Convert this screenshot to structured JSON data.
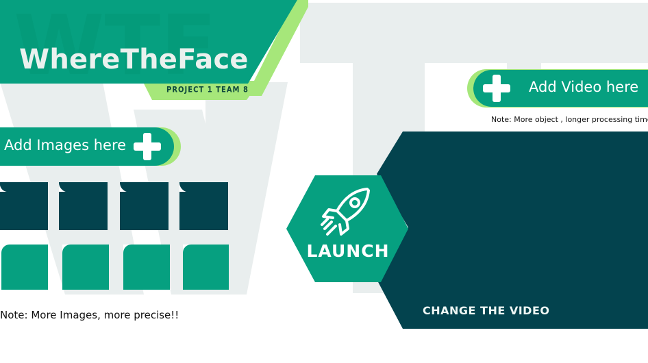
{
  "header": {
    "watermark_text": "WTF",
    "app_title": "WhereTheFace",
    "subtitle": "PROJECT 1 TEAM 8"
  },
  "images": {
    "add_label": "Add Images here",
    "note": "Note: More Images, more precise!!",
    "slots_top_count": 4,
    "slots_bottom_count": 4
  },
  "video": {
    "add_label": "Add Video here",
    "note": "Note: More object , longer processing time",
    "change_label": "CHANGE THE VIDEO"
  },
  "launch": {
    "label": "LAUNCH",
    "icon": "rocket-icon"
  },
  "colors": {
    "primary_green": "#06a080",
    "light_green": "#a6e77a",
    "dark_teal": "#03434e",
    "watermark": "#e8eeee"
  }
}
